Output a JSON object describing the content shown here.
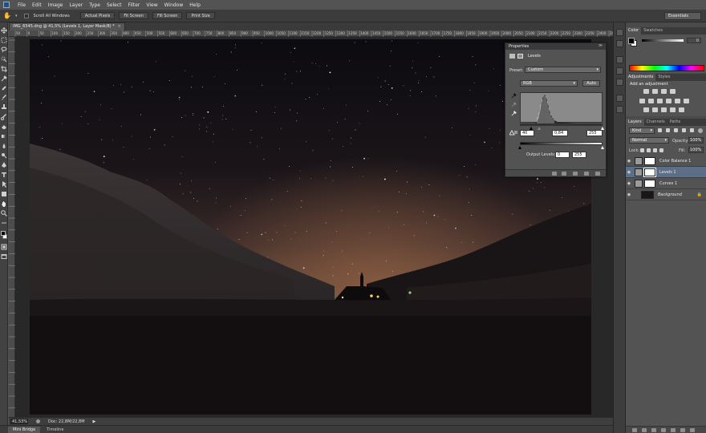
{
  "app": {
    "menu": [
      "File",
      "Edit",
      "Image",
      "Layer",
      "Type",
      "Select",
      "Filter",
      "View",
      "Window",
      "Help"
    ]
  },
  "options": {
    "scroll_all": "Scroll All Windows",
    "buttons": [
      "Actual Pixels",
      "Fit Screen",
      "Fill Screen",
      "Print Size"
    ],
    "workspace": "Essentials"
  },
  "document": {
    "tab_title": "IMG_6545.dng @ 41,5% (Levels 1, Layer Mask/8) *",
    "tab_close": "×",
    "zoom": "41,53%",
    "doc_info": "Doc: 22,8M/22,8M"
  },
  "ruler_labels": [
    "50",
    "0",
    "50",
    "100",
    "150",
    "200",
    "250",
    "300",
    "350",
    "400",
    "450",
    "500",
    "550",
    "600",
    "650",
    "700",
    "750",
    "800",
    "850",
    "900",
    "950",
    "1000",
    "1050",
    "1100",
    "1150",
    "1200",
    "1250",
    "1300",
    "1350",
    "1400",
    "1450",
    "1500",
    "1550",
    "1600",
    "1650",
    "1700",
    "1750",
    "1800",
    "1850",
    "1900",
    "1950",
    "2000",
    "2050",
    "2100",
    "2150",
    "2200",
    "2250",
    "2300",
    "2350",
    "2400",
    "2450"
  ],
  "bottom_tabs": [
    "Mini Bridge",
    "Timeline"
  ],
  "properties": {
    "title": "Properties",
    "close": "≫",
    "panel_name": "Levels",
    "preset_label": "Preset:",
    "preset_value": "Custom",
    "channel": "RGB",
    "auto_label": "Auto",
    "input_black": "40",
    "input_gamma": "0,84",
    "input_white": "255",
    "output_label": "Output Levels:",
    "output_black": "0",
    "output_white": "255"
  },
  "right": {
    "color_tabs": [
      "Color",
      "Swatches"
    ],
    "color_r_value": "0",
    "adj_tabs": [
      "Adjustments",
      "Styles"
    ],
    "add_adjustment": "Add an adjustment",
    "layer_tabs": [
      "Layers",
      "Channels",
      "Paths"
    ],
    "kind_label": "Kind",
    "blend_mode": "Normal",
    "opacity_label": "Opacity:",
    "opacity_value": "100%",
    "lock_label": "Lock:",
    "fill_label": "Fill:",
    "fill_value": "100%",
    "layers": [
      {
        "name": "Color Balance 1"
      },
      {
        "name": "Levels 1"
      },
      {
        "name": "Curves 1"
      },
      {
        "name": "Background"
      }
    ]
  },
  "colors": {
    "ui_bg": "#535353",
    "selected_layer": "#5d6f87",
    "sky_top": "#0b0b10",
    "horizon_glow": "#6b4b3a"
  }
}
